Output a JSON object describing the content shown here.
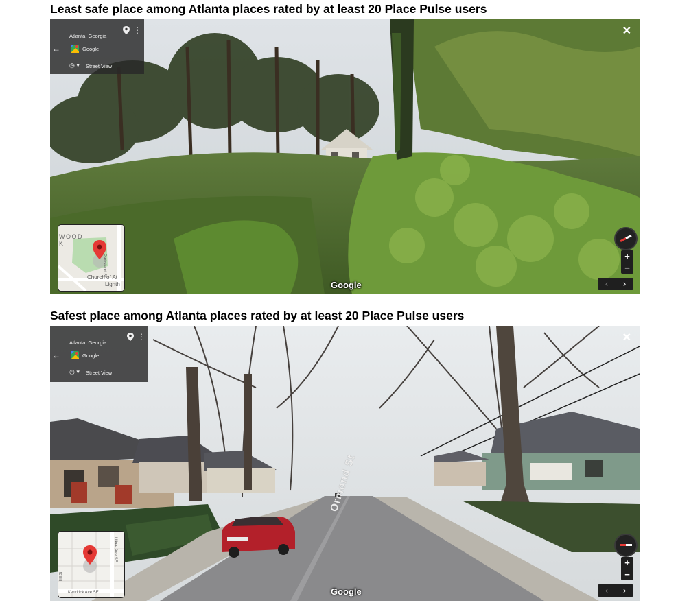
{
  "heading_least": "Least safe place among Atlanta places rated by at least 20 Place Pulse users",
  "heading_safest": "Safest place among Atlanta places rated by at least 20 Place Pulse users",
  "panels": [
    {
      "location": "Atlanta, Georgia",
      "provider": "Google",
      "view_mode": "Street View",
      "watermark": "Google",
      "map_labels": [
        "WOOD",
        "K",
        "Church of At",
        "Lighth",
        "Parksland St"
      ]
    },
    {
      "location": "Atlanta, Georgia",
      "provider": "Google",
      "view_mode": "Street View",
      "watermark": "Google",
      "street_name": "Ormond St",
      "map_labels": [
        "Ulkee Ave SE",
        "Kendrick Ave SE",
        "Hill St"
      ]
    }
  ],
  "controls": {
    "close_icon": "close-icon",
    "back_icon": "arrow-left-icon",
    "pin_icon": "map-pin-icon",
    "menu_icon": "more-vertical-icon",
    "history_icon": "clock-icon",
    "compass_icon": "compass-icon",
    "zoom_in": "+",
    "zoom_out": "−",
    "prev": "‹",
    "next": "›"
  }
}
